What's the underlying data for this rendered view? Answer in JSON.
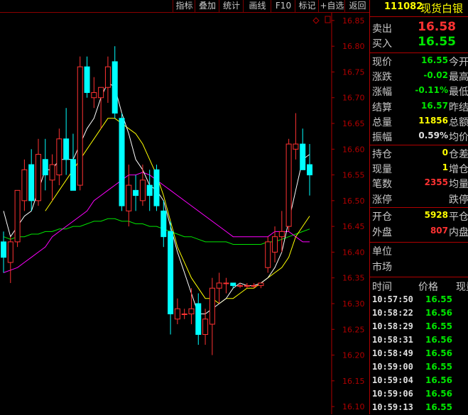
{
  "toolbar": {
    "buttons": [
      "指标",
      "叠加",
      "统计",
      "画线",
      "F10",
      "标记",
      "+自选",
      "返回"
    ]
  },
  "header": {
    "code": "111082",
    "name": "现货白银"
  },
  "quote": {
    "sell": {
      "label": "卖出",
      "value": "16.58"
    },
    "buy": {
      "label": "买入",
      "value": "16.55"
    },
    "rows": [
      {
        "label": "现价",
        "value": "16.55",
        "color": "#00e600",
        "label2": "今开"
      },
      {
        "label": "涨跌",
        "value": "-0.02",
        "color": "#00e600",
        "label2": "最高"
      },
      {
        "label": "涨幅",
        "value": "-0.11%",
        "color": "#00e600",
        "label2": "最低"
      },
      {
        "label": "结算",
        "value": "16.57",
        "color": "#00e600",
        "label2": "昨结"
      },
      {
        "label": "总量",
        "value": "11856",
        "color": "#ffff00",
        "label2": "总额"
      },
      {
        "label": "振幅",
        "value": "0.59%",
        "color": "#e0e0e0",
        "label2": "均价"
      }
    ],
    "rows2": [
      {
        "label": "持仓",
        "value": "0",
        "color": "#ffff00",
        "label2": "仓差"
      },
      {
        "label": "现量",
        "value": "1",
        "color": "#ffff00",
        "label2": "增仓"
      },
      {
        "label": "笔数",
        "value": "2355",
        "color": "#ff3232",
        "label2": "均量"
      },
      {
        "label": "涨停",
        "value": "",
        "color": "#e0e0e0",
        "label2": "跌停"
      }
    ],
    "rows3": [
      {
        "label": "开仓",
        "value": "5928",
        "color": "#ffff00",
        "label2": "平仓"
      },
      {
        "label": "外盘",
        "value": "807",
        "color": "#ff3232",
        "label2": "内盘"
      }
    ],
    "unit_label": "单位",
    "market_label": "市场"
  },
  "ticks": {
    "headers": [
      "时间",
      "价格",
      "现量"
    ],
    "rows": [
      {
        "time": "10:57:50",
        "price": "16.55"
      },
      {
        "time": "10:58:22",
        "price": "16.56"
      },
      {
        "time": "10:58:29",
        "price": "16.55"
      },
      {
        "time": "10:58:31",
        "price": "16.56"
      },
      {
        "time": "10:58:49",
        "price": "16.56"
      },
      {
        "time": "10:59:00",
        "price": "16.55"
      },
      {
        "time": "10:59:04",
        "price": "16.56"
      },
      {
        "time": "10:59:06",
        "price": "16.56"
      },
      {
        "time": "10:59:13",
        "price": "16.55"
      }
    ]
  },
  "chart_data": {
    "type": "candlestick",
    "y_ticks": [
      "16.85",
      "16.80",
      "16.75",
      "16.70",
      "16.65",
      "16.60",
      "16.55",
      "16.50",
      "16.45",
      "16.40",
      "16.35",
      "16.30",
      "16.25",
      "16.20",
      "16.15",
      "16.10"
    ],
    "ylim": [
      16.085,
      16.865
    ],
    "colors": {
      "up": "#ff3232",
      "down": "#00ffff",
      "ma5": "#ffffff",
      "ma10": "#ffff00",
      "ma20": "#ff00ff",
      "ma60": "#00e600"
    },
    "candles": [
      {
        "o": 16.42,
        "h": 16.44,
        "l": 16.36,
        "c": 16.39
      },
      {
        "o": 16.38,
        "h": 16.43,
        "l": 16.34,
        "c": 16.42
      },
      {
        "o": 16.42,
        "h": 16.52,
        "l": 16.41,
        "c": 16.52
      },
      {
        "o": 16.5,
        "h": 16.58,
        "l": 16.48,
        "c": 16.56
      },
      {
        "o": 16.57,
        "h": 16.6,
        "l": 16.48,
        "c": 16.5
      },
      {
        "o": 16.5,
        "h": 16.62,
        "l": 16.49,
        "c": 16.59
      },
      {
        "o": 16.58,
        "h": 16.62,
        "l": 16.52,
        "c": 16.55
      },
      {
        "o": 16.54,
        "h": 16.59,
        "l": 16.5,
        "c": 16.57
      },
      {
        "o": 16.55,
        "h": 16.64,
        "l": 16.53,
        "c": 16.62
      },
      {
        "o": 16.62,
        "h": 16.68,
        "l": 16.55,
        "c": 16.58
      },
      {
        "o": 16.58,
        "h": 16.63,
        "l": 16.52,
        "c": 16.52
      },
      {
        "o": 16.53,
        "h": 16.78,
        "l": 16.52,
        "c": 16.76
      },
      {
        "o": 16.76,
        "h": 16.78,
        "l": 16.7,
        "c": 16.71
      },
      {
        "o": 16.7,
        "h": 16.74,
        "l": 16.68,
        "c": 16.71
      },
      {
        "o": 16.7,
        "h": 16.72,
        "l": 16.64,
        "c": 16.72
      },
      {
        "o": 16.72,
        "h": 16.78,
        "l": 16.69,
        "c": 16.76
      },
      {
        "o": 16.77,
        "h": 16.8,
        "l": 16.66,
        "c": 16.67
      },
      {
        "o": 16.66,
        "h": 16.67,
        "l": 16.48,
        "c": 16.49
      },
      {
        "o": 16.48,
        "h": 16.57,
        "l": 16.45,
        "c": 16.53
      },
      {
        "o": 16.52,
        "h": 16.55,
        "l": 16.48,
        "c": 16.51
      },
      {
        "o": 16.5,
        "h": 16.57,
        "l": 16.49,
        "c": 16.54
      },
      {
        "o": 16.53,
        "h": 16.56,
        "l": 16.48,
        "c": 16.51
      },
      {
        "o": 16.56,
        "h": 16.57,
        "l": 16.48,
        "c": 16.49
      },
      {
        "o": 16.48,
        "h": 16.5,
        "l": 16.41,
        "c": 16.43
      },
      {
        "o": 16.44,
        "h": 16.46,
        "l": 16.24,
        "c": 16.28
      },
      {
        "o": 16.27,
        "h": 16.31,
        "l": 16.26,
        "c": 16.29
      },
      {
        "o": 16.28,
        "h": 16.29,
        "l": 16.27,
        "c": 16.28
      },
      {
        "o": 16.28,
        "h": 16.33,
        "l": 16.26,
        "c": 16.29
      },
      {
        "o": 16.3,
        "h": 16.32,
        "l": 16.22,
        "c": 16.24
      },
      {
        "o": 16.24,
        "h": 16.29,
        "l": 16.22,
        "c": 16.27
      },
      {
        "o": 16.26,
        "h": 16.35,
        "l": 16.2,
        "c": 16.33
      },
      {
        "o": 16.33,
        "h": 16.36,
        "l": 16.3,
        "c": 16.34
      },
      {
        "o": 16.34,
        "h": 16.35,
        "l": 16.32,
        "c": 16.34
      },
      {
        "o": 16.34,
        "h": 16.34,
        "l": 16.33,
        "c": 16.335
      },
      {
        "o": 16.335,
        "h": 16.34,
        "l": 16.33,
        "c": 16.335
      },
      {
        "o": 16.335,
        "h": 16.34,
        "l": 16.33,
        "c": 16.335
      },
      {
        "o": 16.335,
        "h": 16.34,
        "l": 16.33,
        "c": 16.335
      },
      {
        "o": 16.335,
        "h": 16.34,
        "l": 16.33,
        "c": 16.34
      },
      {
        "o": 16.37,
        "h": 16.43,
        "l": 16.36,
        "c": 16.42
      },
      {
        "o": 16.4,
        "h": 16.45,
        "l": 16.38,
        "c": 16.43
      },
      {
        "o": 16.43,
        "h": 16.48,
        "l": 16.4,
        "c": 16.44
      },
      {
        "o": 16.45,
        "h": 16.62,
        "l": 16.44,
        "c": 16.61
      },
      {
        "o": 16.6,
        "h": 16.67,
        "l": 16.58,
        "c": 16.61
      },
      {
        "o": 16.61,
        "h": 16.64,
        "l": 16.56,
        "c": 16.56
      },
      {
        "o": 16.57,
        "h": 16.61,
        "l": 16.51,
        "c": 16.55
      }
    ],
    "ma5": [
      16.48,
      16.43,
      16.45,
      16.47,
      16.48,
      16.52,
      16.56,
      16.56,
      16.58,
      16.58,
      16.58,
      16.61,
      16.64,
      16.66,
      16.7,
      16.73,
      16.72,
      16.67,
      16.63,
      16.58,
      16.56,
      16.53,
      16.52,
      16.5,
      16.45,
      16.4,
      16.36,
      16.32,
      16.28,
      16.28,
      16.29,
      16.3,
      16.31,
      16.33,
      16.34,
      16.335,
      16.335,
      16.34,
      16.35,
      16.37,
      16.4,
      16.46,
      16.52,
      16.58,
      16.59
    ],
    "ma10": [
      null,
      null,
      null,
      null,
      null,
      null,
      16.48,
      16.5,
      16.52,
      16.54,
      16.56,
      16.58,
      16.6,
      16.62,
      16.64,
      16.66,
      16.66,
      16.65,
      16.64,
      16.63,
      16.61,
      16.58,
      16.55,
      16.51,
      16.46,
      16.41,
      16.38,
      16.35,
      16.33,
      16.31,
      16.31,
      16.3,
      16.31,
      16.31,
      16.32,
      16.33,
      16.33,
      16.34,
      16.35,
      16.36,
      16.37,
      16.39,
      16.43,
      16.45,
      16.47
    ],
    "ma20": [
      16.36,
      16.365,
      16.37,
      16.38,
      16.39,
      16.4,
      16.41,
      16.43,
      16.44,
      16.45,
      16.46,
      16.47,
      16.48,
      16.5,
      16.51,
      16.52,
      16.53,
      16.54,
      16.55,
      16.55,
      16.555,
      16.55,
      16.54,
      16.53,
      16.52,
      16.51,
      16.5,
      16.49,
      16.48,
      16.47,
      16.46,
      16.45,
      16.44,
      16.43,
      16.43,
      16.43,
      16.43,
      16.43,
      16.43,
      16.44,
      16.44,
      16.44,
      16.43,
      16.42,
      16.42
    ],
    "ma60": [
      16.43,
      16.425,
      16.43,
      16.43,
      16.435,
      16.435,
      16.44,
      16.44,
      16.445,
      16.445,
      16.45,
      16.45,
      16.455,
      16.46,
      16.46,
      16.465,
      16.465,
      16.46,
      16.46,
      16.455,
      16.455,
      16.45,
      16.45,
      16.445,
      16.44,
      16.435,
      16.43,
      16.43,
      16.425,
      16.42,
      16.42,
      16.42,
      16.42,
      16.415,
      16.415,
      16.415,
      16.415,
      16.415,
      16.42,
      16.42,
      16.425,
      16.43,
      16.435,
      16.44,
      16.445
    ]
  }
}
